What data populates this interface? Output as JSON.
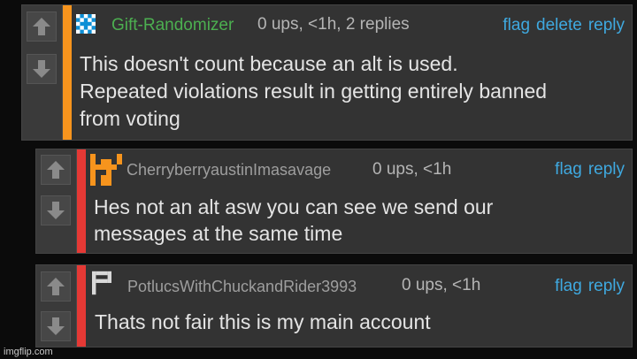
{
  "comments": [
    {
      "username": "Gift-Randomizer",
      "username_color": "#4caf50",
      "meta": "0 ups, <1h, 2 replies",
      "actions": [
        "flag",
        "delete",
        "reply"
      ],
      "body_lines": [
        "This doesn't count because an alt is used.",
        "Repeated violations result in getting entirely banned",
        "from voting"
      ],
      "bar_color": "#f7941d",
      "avatar_icon": "pixel-avatar-icon"
    },
    {
      "username": "CherryberryaustinImasavage",
      "username_color": "#9e9e9e",
      "meta": "0 ups, <1h",
      "actions": [
        "flag",
        "reply"
      ],
      "body_lines": [
        "Hes not an alt asw you can see we send our",
        "messages at the same time"
      ],
      "bar_color": "#e53935",
      "avatar_icon": "pixel-avatar-icon"
    },
    {
      "username": "PotlucsWithChuckandRider3993",
      "username_color": "#9e9e9e",
      "meta": "0 ups, <1h",
      "actions": [
        "flag",
        "reply"
      ],
      "body_lines": [
        "Thats not fair this is my main account"
      ],
      "bar_color": "#e53935",
      "avatar_icon": "pixel-avatar-icon"
    }
  ],
  "watermark": "imgflip.com",
  "vote_icons": [
    "upvote-arrow-icon",
    "downvote-arrow-icon"
  ]
}
